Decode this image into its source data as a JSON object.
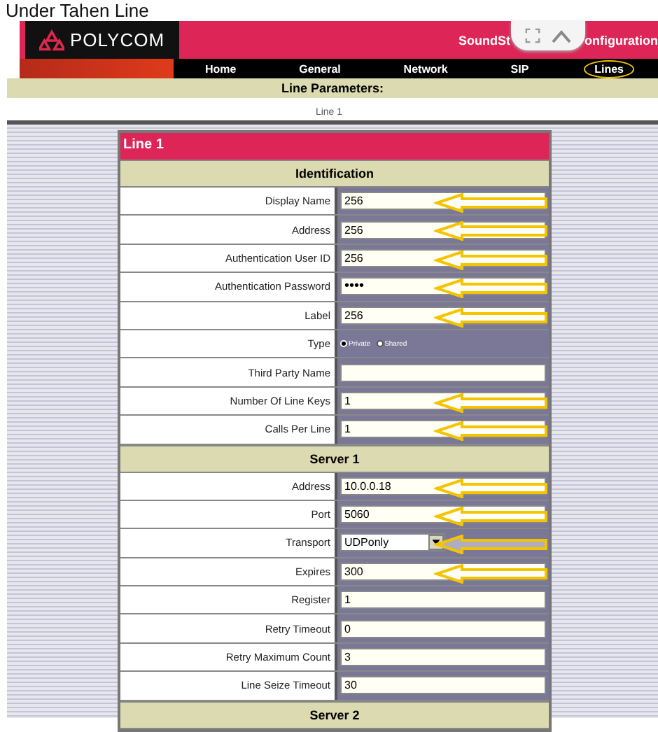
{
  "caption": "Under Tahen Line",
  "header": {
    "logo": "POLYCOM",
    "title_start": "SoundSt",
    "title_end": "onfiguration"
  },
  "nav": [
    {
      "label": "Home",
      "circled": false
    },
    {
      "label": "General",
      "circled": false
    },
    {
      "label": "Network",
      "circled": false
    },
    {
      "label": "SIP",
      "circled": false
    },
    {
      "label": "Lines",
      "circled": true
    }
  ],
  "page_title": "Line Parameters:",
  "breadcrumb": "Line 1",
  "panel_title": "Line 1",
  "sections": [
    {
      "title": "Identification",
      "rows": [
        {
          "label": "Display Name",
          "kind": "text",
          "value": "256",
          "annotated": true
        },
        {
          "label": "Address",
          "kind": "text",
          "value": "256",
          "annotated": true
        },
        {
          "label": "Authentication User ID",
          "kind": "text",
          "value": "256",
          "annotated": true
        },
        {
          "label": "Authentication Password",
          "kind": "password",
          "value": "••••",
          "annotated": true
        },
        {
          "label": "Label",
          "kind": "text",
          "value": "256",
          "annotated": true
        },
        {
          "label": "Type",
          "kind": "radio",
          "options": [
            {
              "label": "Private",
              "selected": true
            },
            {
              "label": "Shared",
              "selected": false
            }
          ],
          "annotated": false
        },
        {
          "label": "Third Party Name",
          "kind": "text",
          "value": "",
          "annotated": false
        },
        {
          "label": "Number Of Line Keys",
          "kind": "text",
          "value": "1",
          "annotated": true
        },
        {
          "label": "Calls Per Line",
          "kind": "text",
          "value": "1",
          "annotated": true
        }
      ]
    },
    {
      "title": "Server 1",
      "rows": [
        {
          "label": "Address",
          "kind": "text",
          "value": "10.0.0.18",
          "annotated": true
        },
        {
          "label": "Port",
          "kind": "text",
          "value": "5060",
          "annotated": true
        },
        {
          "label": "Transport",
          "kind": "select",
          "value": "UDPonly",
          "annotated": true
        },
        {
          "label": "Expires",
          "kind": "text",
          "value": "300",
          "annotated": true
        },
        {
          "label": "Register",
          "kind": "text",
          "value": "1",
          "annotated": false
        },
        {
          "label": "Retry Timeout",
          "kind": "text",
          "value": "0",
          "annotated": false
        },
        {
          "label": "Retry Maximum Count",
          "kind": "text",
          "value": "3",
          "annotated": false
        },
        {
          "label": "Line Seize Timeout",
          "kind": "text",
          "value": "30",
          "annotated": false
        }
      ]
    },
    {
      "title": "Server 2"
    }
  ]
}
